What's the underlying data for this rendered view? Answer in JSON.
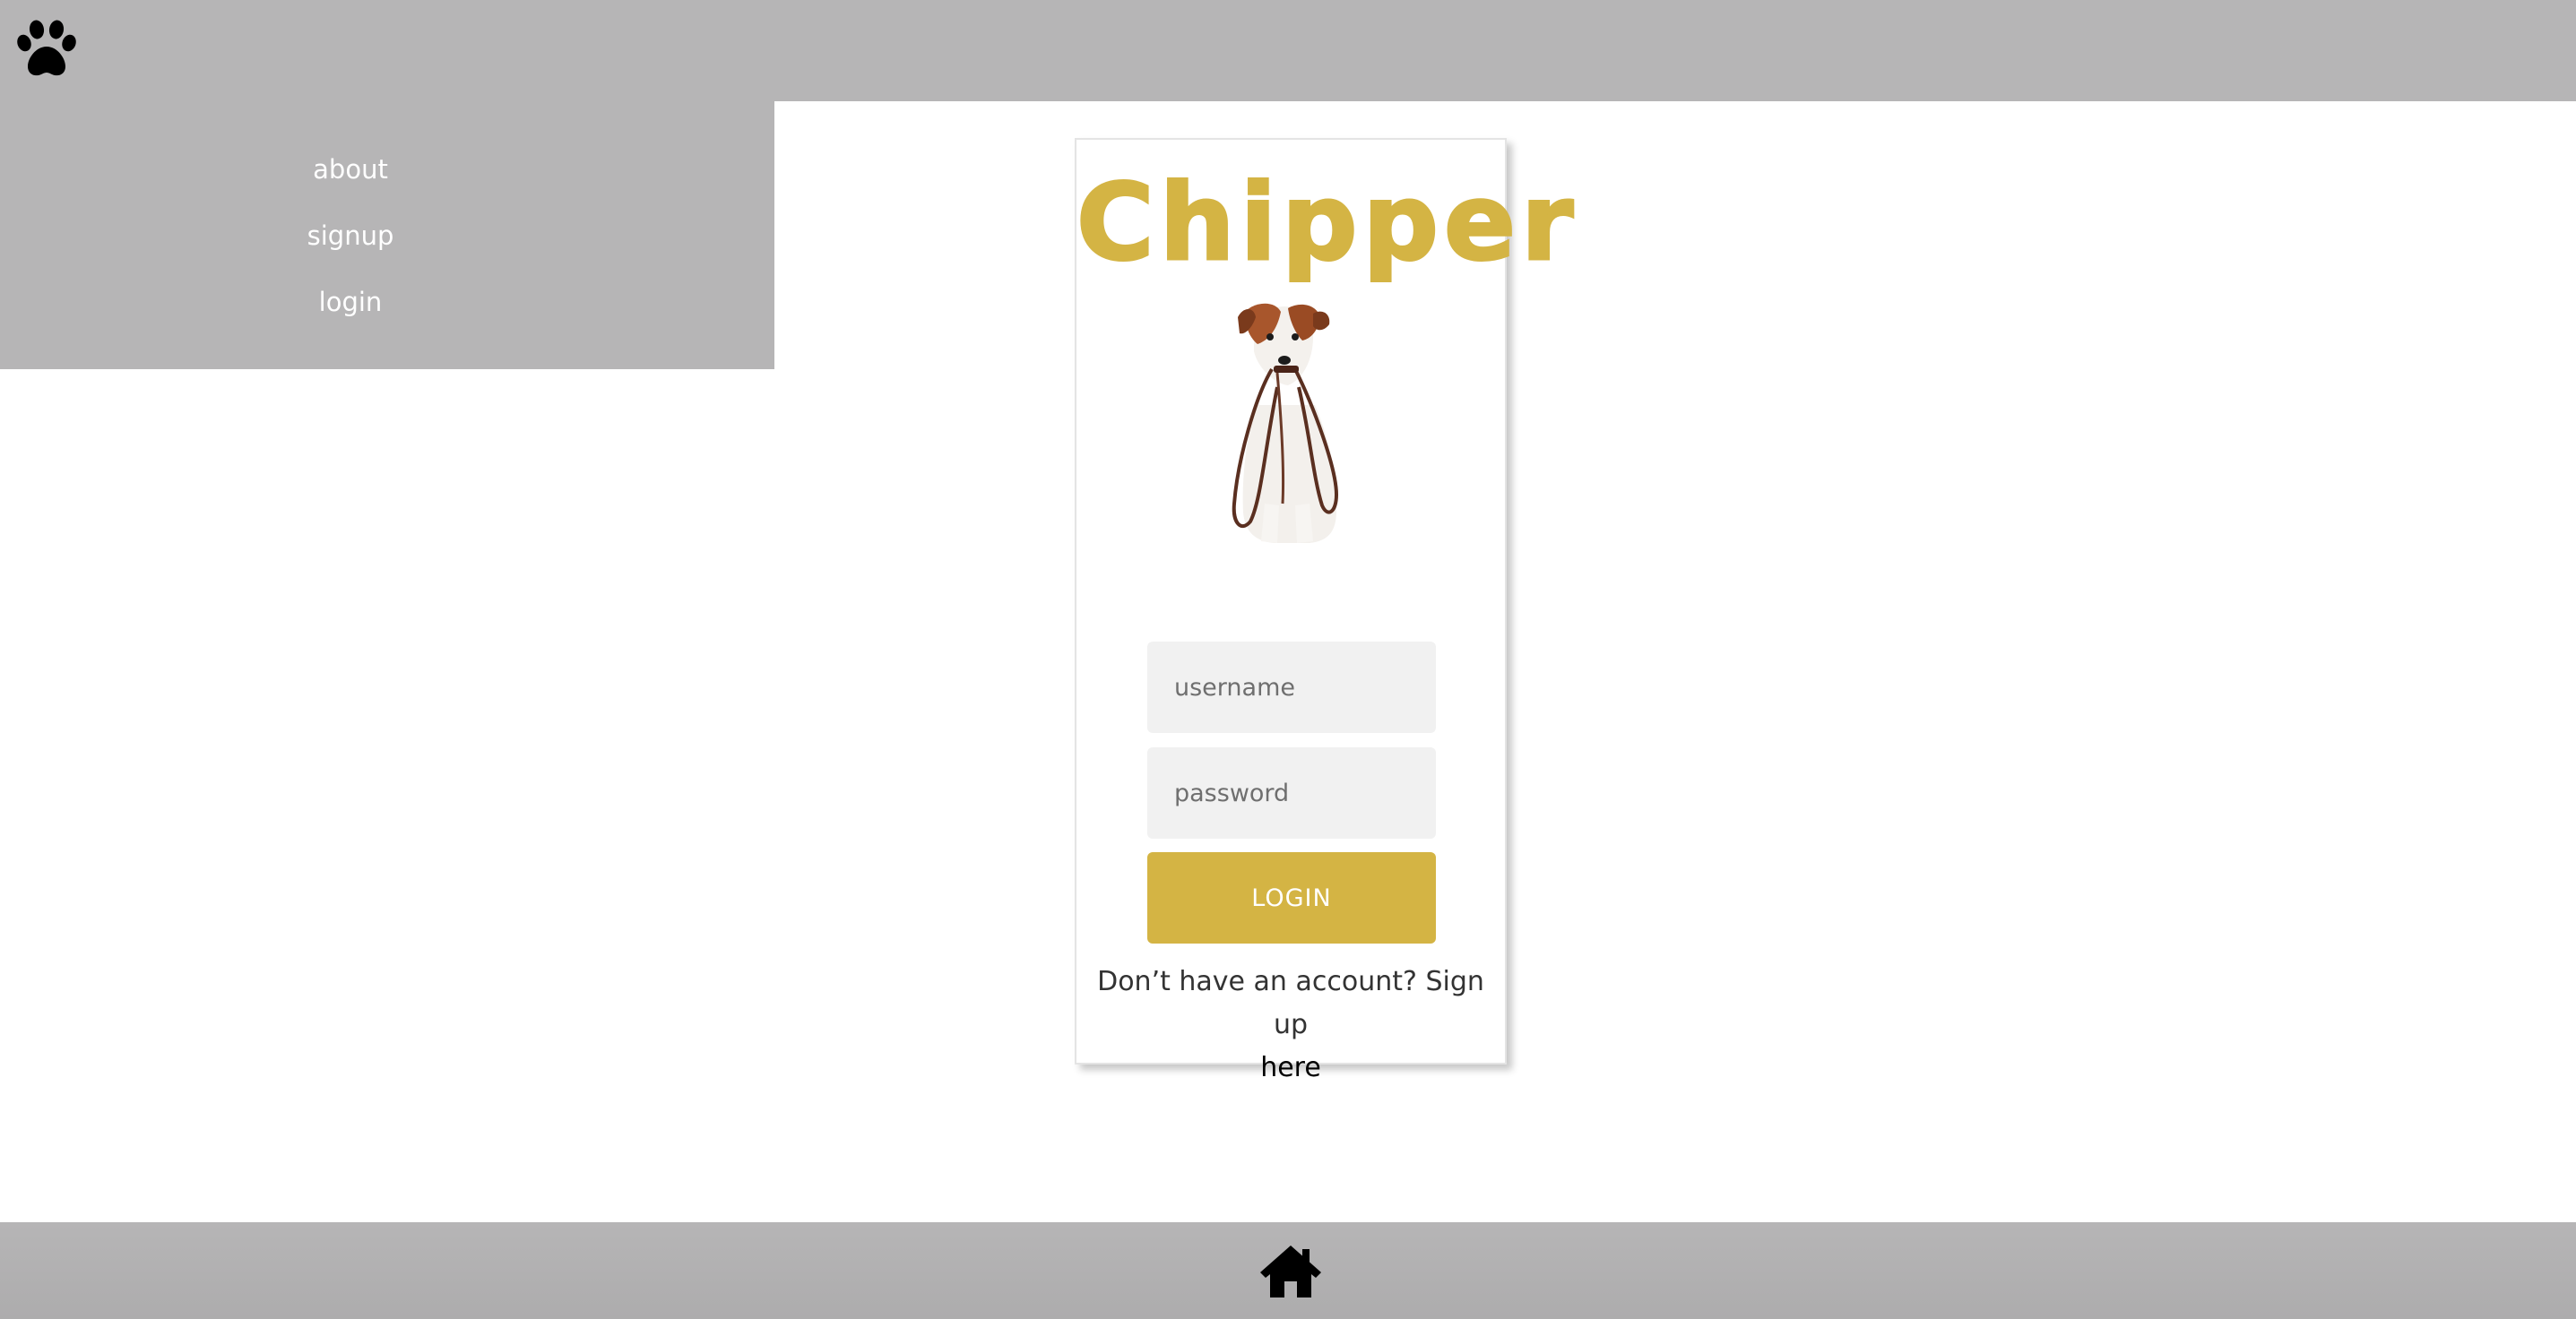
{
  "header": {
    "menu_icon": "paw-icon"
  },
  "nav": {
    "items": [
      {
        "label": "about"
      },
      {
        "label": "signup"
      },
      {
        "label": "login"
      }
    ]
  },
  "login_card": {
    "brand": "Chipper",
    "image": "dog-with-leash",
    "username_placeholder": "username",
    "password_placeholder": "password",
    "login_label": "LOGIN",
    "signup_prompt": "Don’t have an account? Sign up",
    "signup_link": "here",
    "accent_color": "#d4b444"
  },
  "footer": {
    "home_icon": "home-icon"
  },
  "colors": {
    "bar_gray": "#b6b5b6",
    "accent": "#d4b444",
    "field_bg": "#f1f1f1"
  }
}
